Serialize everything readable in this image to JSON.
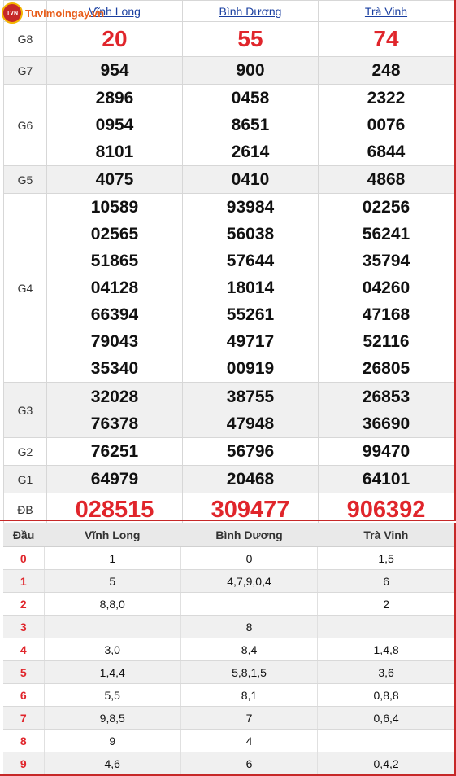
{
  "logo": {
    "text": "Tuvimoingay.vn",
    "badge": "TVN"
  },
  "provinces": [
    "Vĩnh Long",
    "Bình Dương",
    "Trà Vinh"
  ],
  "prizes": {
    "g8": {
      "label": "G8",
      "values": [
        "20",
        "55",
        "74"
      ]
    },
    "g7": {
      "label": "G7",
      "values": [
        "954",
        "900",
        "248"
      ]
    },
    "g6": {
      "label": "G6",
      "values": [
        [
          "2896",
          "0954",
          "8101"
        ],
        [
          "0458",
          "8651",
          "2614"
        ],
        [
          "2322",
          "0076",
          "6844"
        ]
      ]
    },
    "g5": {
      "label": "G5",
      "values": [
        "4075",
        "0410",
        "4868"
      ]
    },
    "g4": {
      "label": "G4",
      "values": [
        [
          "10589",
          "02565",
          "51865",
          "04128",
          "66394",
          "79043",
          "35340"
        ],
        [
          "93984",
          "56038",
          "57644",
          "18014",
          "55261",
          "49717",
          "00919"
        ],
        [
          "02256",
          "56241",
          "35794",
          "04260",
          "47168",
          "52116",
          "26805"
        ]
      ]
    },
    "g3": {
      "label": "G3",
      "values": [
        [
          "32028",
          "76378"
        ],
        [
          "38755",
          "47948"
        ],
        [
          "26853",
          "36690"
        ]
      ]
    },
    "g2": {
      "label": "G2",
      "values": [
        "76251",
        "56796",
        "99470"
      ]
    },
    "g1": {
      "label": "G1",
      "values": [
        "64979",
        "20468",
        "64101"
      ]
    },
    "db": {
      "label": "ĐB",
      "values": [
        "028515",
        "309477",
        "906392"
      ]
    }
  },
  "loto": {
    "header": "Đầu",
    "columns": [
      "Vĩnh Long",
      "Bình Dương",
      "Trà Vinh"
    ],
    "rows": [
      {
        "head": "0",
        "cells": [
          "1",
          "0",
          "1,5"
        ]
      },
      {
        "head": "1",
        "cells": [
          "5",
          "4,7,9,0,4",
          "6"
        ]
      },
      {
        "head": "2",
        "cells": [
          "8,8,0",
          "",
          "2"
        ]
      },
      {
        "head": "3",
        "cells": [
          "",
          "8",
          ""
        ]
      },
      {
        "head": "4",
        "cells": [
          "3,0",
          "8,4",
          "1,4,8"
        ]
      },
      {
        "head": "5",
        "cells": [
          "1,4,4",
          "5,8,1,5",
          "3,6"
        ]
      },
      {
        "head": "6",
        "cells": [
          "5,5",
          "8,1",
          "0,8,8"
        ]
      },
      {
        "head": "7",
        "cells": [
          "9,8,5",
          "7",
          "0,6,4"
        ]
      },
      {
        "head": "8",
        "cells": [
          "9",
          "4",
          ""
        ]
      },
      {
        "head": "9",
        "cells": [
          "4,6",
          "6",
          "0,4,2"
        ]
      }
    ]
  },
  "colors": {
    "accent": "#e0252b",
    "border": "#c62828",
    "link": "#1a3fa0"
  }
}
